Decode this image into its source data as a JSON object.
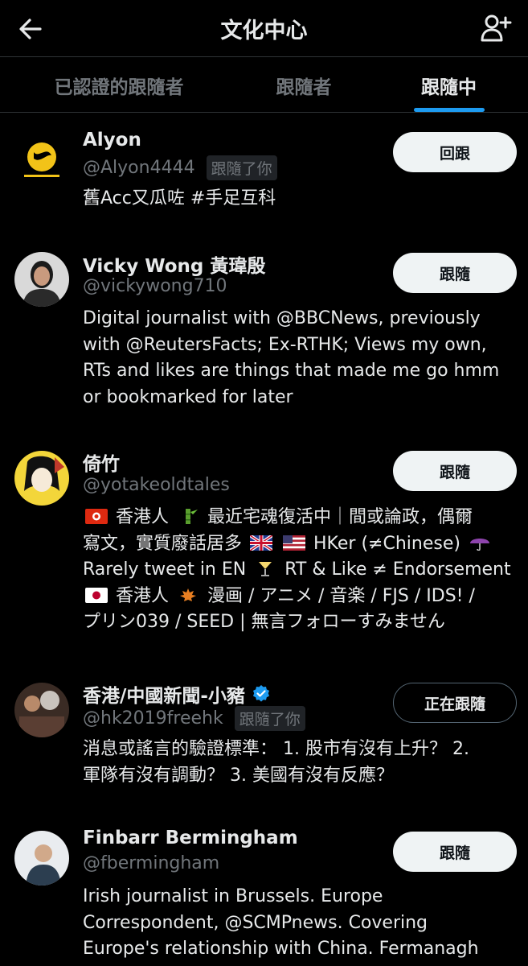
{
  "header": {
    "title": "文化中心",
    "back_icon": "arrow-left-icon",
    "add_icon": "person-add-icon"
  },
  "tabs": [
    {
      "label": "已認證的跟隨者",
      "active": false
    },
    {
      "label": "跟隨者",
      "active": false
    },
    {
      "label": "跟隨中",
      "active": true
    }
  ],
  "accent": "#1d9bf0",
  "users": [
    {
      "name": "Alyon",
      "handle": "@Alyon4444",
      "follows_you": "跟隨了你",
      "button": "回跟",
      "bio": "舊Acc又瓜咗 #手足互科"
    },
    {
      "name": "Vicky Wong 黃瑋殷",
      "handle": "@vickywong710",
      "button": "跟隨",
      "bio_lines": [
        "Digital journalist with @BBCNews, previously",
        "with @ReutersFacts; Ex-RTHK; Views my own,",
        "RTs and likes are things that made me go hmm",
        "or bookmarked for later"
      ]
    },
    {
      "name": "倚竹",
      "handle": "@yotakeoldtales",
      "button": "跟隨",
      "bio_segments": {
        "l1": "香港人",
        "l1b": "最近宅魂復活中｜間或論政，偶爾",
        "l2": "寫文，實質廢話居多",
        "l2b": "HKer (≠Chinese)",
        "l3": "Rarely tweet in EN",
        "l3b": "RT & Like ≠ Endorsement",
        "l4": "香港人",
        "l4b": "漫画 / アニメ / 音楽 / FJS / IDS! /",
        "l5": "プリン039 / SEED | 無言フォローすみません"
      }
    },
    {
      "name": "香港/中國新聞-小豬",
      "verified": true,
      "handle": "@hk2019freehk",
      "follows_you": "跟隨了你",
      "button": "正在跟隨",
      "bio_lines": [
        "消息或謠言的驗證標準： 1. 股市有沒有上升？ 2.",
        "軍隊有沒有調動？ 3. 美國有沒有反應？"
      ]
    },
    {
      "name": "Finbarr Bermingham",
      "handle": "@fbermingham",
      "button": "跟隨",
      "bio_lines": [
        "Irish journalist in Brussels. Europe",
        "Correspondent, @SCMPnews. Covering",
        "Europe's relationship with China. Fermanagh"
      ]
    }
  ]
}
